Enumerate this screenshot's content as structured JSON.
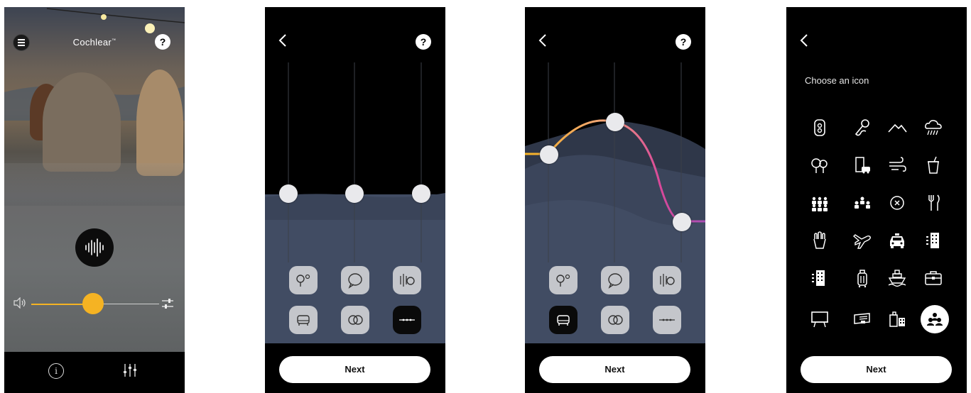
{
  "screen1": {
    "brand": "Cochlear",
    "brand_mark": "™",
    "help_glyph": "?",
    "info_glyph": "i",
    "volume_level": 0.47,
    "icons": [
      "menu-icon",
      "help-icon",
      "waveform-icon",
      "speaker-icon",
      "adjust-icon",
      "info-icon",
      "equalizer-icon"
    ]
  },
  "screen2": {
    "help_glyph": "?",
    "next_label": "Next",
    "tiles": [
      "outdoor-sun-icon",
      "speech-bubble-icon",
      "noise-hand-icon",
      "sofa-icon",
      "faces-conversation-icon",
      "flat-wave-icon"
    ],
    "selected_tile": "flat-wave-icon",
    "levels": [
      0.5,
      0.5,
      0.5
    ]
  },
  "screen3": {
    "help_glyph": "?",
    "next_label": "Next",
    "tiles": [
      "outdoor-sun-icon",
      "speech-bubble-icon",
      "noise-hand-icon",
      "sofa-icon",
      "faces-conversation-icon",
      "flat-wave-icon"
    ],
    "selected_tile": "sofa-icon",
    "levels": [
      0.55,
      0.75,
      0.2
    ]
  },
  "screen4": {
    "title": "Choose an icon",
    "next_label": "Next",
    "icons": [
      "hearing-aid-icon",
      "microphone-icon",
      "mountains-icon",
      "rain-cloud-icon",
      "trees-icon",
      "building-car-icon",
      "wind-icon",
      "drink-cup-icon",
      "crowd-icon",
      "group-icon",
      "speech-cancel-icon",
      "fork-knife-icon",
      "popcorn-icon",
      "airplane-icon",
      "taxi-icon",
      "office-building-icon",
      "apartment-icon",
      "luggage-icon",
      "ship-icon",
      "briefcase-icon",
      "presentation-icon",
      "bus-stop-icon",
      "buildings-icon",
      "group-circle-icon"
    ],
    "selected_icon": "group-circle-icon"
  },
  "colors": {
    "accent_yellow": "#f5b323",
    "accent_pink": "#d9489a",
    "panel_blue": "#414c63",
    "background": "#000000"
  }
}
